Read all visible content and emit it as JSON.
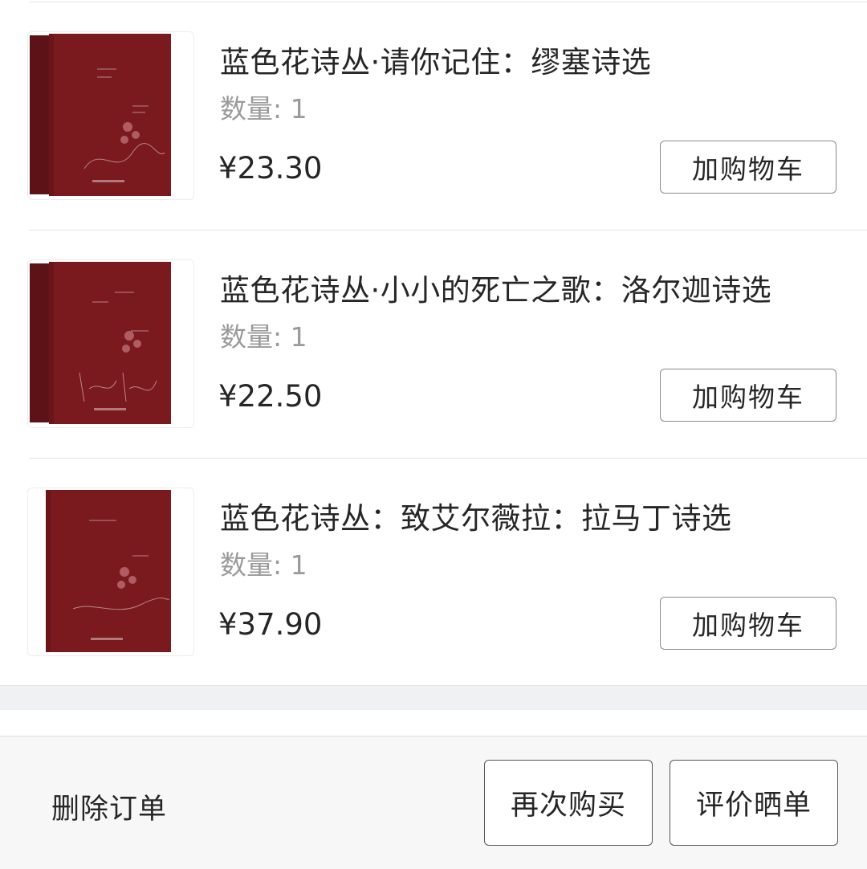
{
  "order_items": [
    {
      "title": "蓝色花诗丛·请你记住：缪塞诗选",
      "quantity": "数量: 1",
      "price": "¥23.30",
      "cart_button": "加购物车",
      "cover_color": "#7a1a1e"
    },
    {
      "title": "蓝色花诗丛·小小的死亡之歌：洛尔迦诗选",
      "quantity": "数量: 1",
      "price": "¥22.50",
      "cart_button": "加购物车",
      "cover_color": "#7a1a1e"
    },
    {
      "title": "蓝色花诗丛：致艾尔薇拉：拉马丁诗选",
      "quantity": "数量: 1",
      "price": "¥37.90",
      "cart_button": "加购物车",
      "cover_color": "#7a1a1e"
    }
  ],
  "footer": {
    "delete_order": "删除订单",
    "rebuy": "再次购买",
    "review": "评价晒单"
  },
  "icons": {
    "cover": "book-cover-image"
  }
}
